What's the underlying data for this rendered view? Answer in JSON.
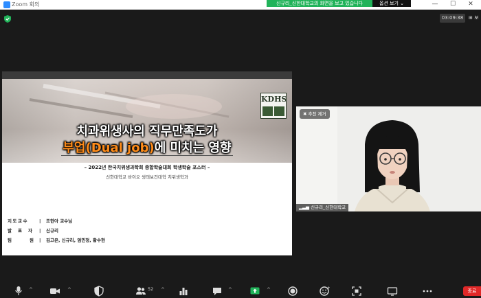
{
  "window": {
    "title": "Zoom 회의",
    "share_banner": "신규리_신한대학교의 화면을 보고 있습니다",
    "view_options": "옵션 보기 ⌄",
    "minimize": "—",
    "maximize": "☐",
    "close": "✕"
  },
  "meeting": {
    "timer": "03:09:38",
    "view_label": "⊞ 보"
  },
  "slide": {
    "logo_text": "KDHS",
    "title_line1": "치과위생사의 직무만족도가",
    "title_line2_orange": "부업(Dual job)",
    "title_line2_white": "에 미치는 영향",
    "subtitle": "– 2022년 한국치위생과학회 종합학술대회 학생학술 포스터 –",
    "affiliation": "신한대학교 바이오 생태보건대학 치위생학과",
    "credits": [
      {
        "label": "지도교수",
        "value": "조한아 교수님"
      },
      {
        "label": "발표자",
        "value": "신규리"
      },
      {
        "label": "팀원",
        "value": "김고은, 신규리, 엄민정, 황수현"
      }
    ],
    "separator": "|"
  },
  "participant": {
    "pin_label": "추천 제거",
    "name": "신규리_신한대학교"
  },
  "toolbar": {
    "participants_count": "52",
    "caret": "^",
    "end_label": "종료"
  },
  "colors": {
    "accent_green": "#21b35a",
    "title_orange": "#ff8c1a",
    "end_red": "#e02828"
  }
}
